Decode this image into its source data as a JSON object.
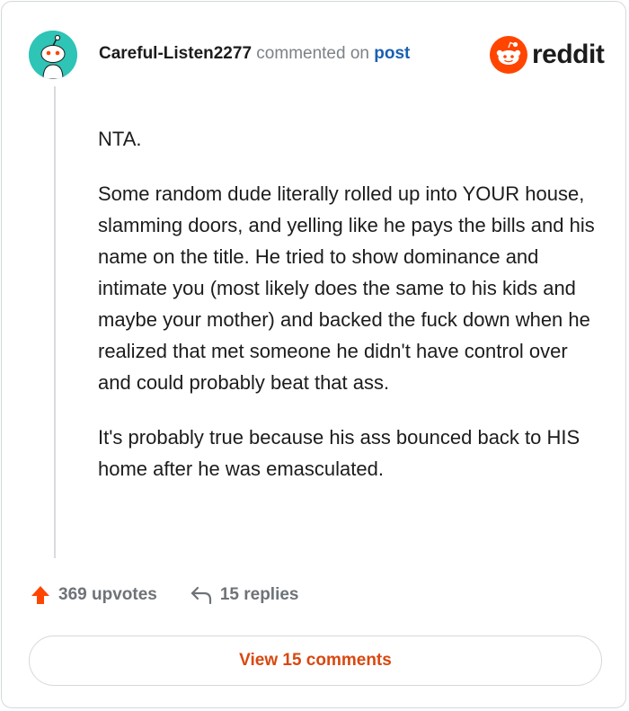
{
  "comment": {
    "username": "Careful-Listen2277",
    "action_text": "commented on",
    "post_link": "post",
    "brand": "reddit",
    "paragraphs": [
      "NTA.",
      "Some random dude literally rolled up into YOUR house, slamming doors, and yelling like he pays the bills and his name on the title. He tried to show dominance and intimate you (most likely does the same to his kids and maybe your mother) and backed the fuck down when he realized that met someone he didn't have control over and could probably beat that ass.",
      "It's probably true because his ass bounced back to HIS home after he was emasculated."
    ]
  },
  "footer": {
    "upvotes": "369 upvotes",
    "replies": "15 replies",
    "view_button": "View 15 comments"
  },
  "colors": {
    "avatar": "#2ec4b6",
    "reddit_orange": "#ff4500",
    "username": "#1c1c1c",
    "post_link": "#1a5fb4",
    "view_button_text": "#d9480f"
  },
  "icons": {
    "avatar": "snoo-avatar-icon",
    "logo": "reddit-snoo-icon",
    "upvote": "upvote-arrow-icon",
    "reply": "reply-arrow-icon"
  }
}
